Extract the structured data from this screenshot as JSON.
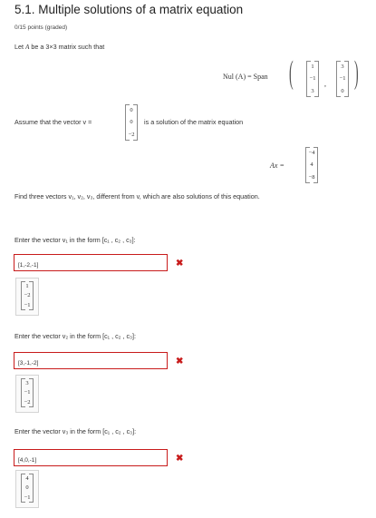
{
  "page": {
    "title": "5.1. Multiple solutions of a matrix equation",
    "points": "0/15 points (graded)"
  },
  "problem": {
    "intro_text": "Let",
    "intro_var": "A",
    "intro_rest": "be a 3×3 matrix such that",
    "nul_label": "Nul (A) = Span",
    "span_vec1": [
      "1",
      "−1",
      "3"
    ],
    "span_vec2": [
      "3",
      "−1",
      "0"
    ],
    "span_sep": ",",
    "assume_text": "Assume that the vector v =",
    "v_vec": [
      "0",
      "0",
      "−2"
    ],
    "assume_rest": "is a solution of the matrix equation",
    "ax_label": "Ax =",
    "b_vec": [
      "−4",
      "4",
      "−8"
    ],
    "find_text": "Find three vectors v₁, v₂, v₃, different from v, which are also solutions of this equation."
  },
  "answers": [
    {
      "prompt": "Enter the vector v₁ in the form [c₁ , c₂ , c₃]:",
      "value": "[1,-2,-1]",
      "preview": [
        "1",
        "−2",
        "−1"
      ],
      "status": "✖"
    },
    {
      "prompt": "Enter the vector v₂ in the form [c₁ , c₂ , c₃]:",
      "value": "[3,-1,-2]",
      "preview": [
        "3",
        "−1",
        "−2"
      ],
      "status": "✖"
    },
    {
      "prompt": "Enter the vector v₃ in the form [c₁ , c₂ , c₃]:",
      "value": "[4,0,-1]",
      "preview": [
        "4",
        "0",
        "−1"
      ],
      "status": "✖"
    }
  ],
  "colors": {
    "error": "#c81b1b"
  }
}
